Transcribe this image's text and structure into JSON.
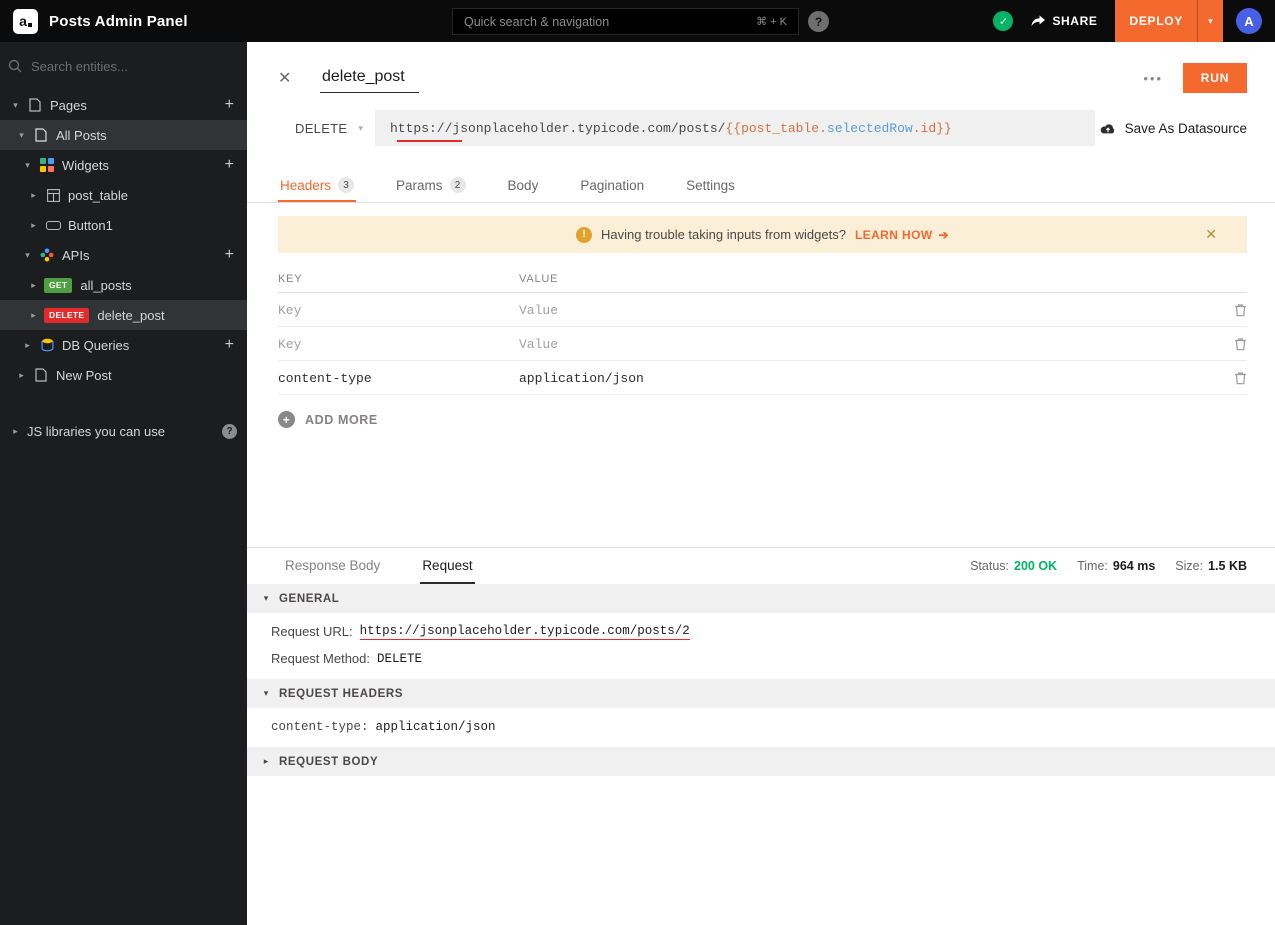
{
  "colors": {
    "accent": "#f3692e",
    "method-red": "#e22c2c",
    "method-green": "#4e9e42",
    "status-green": "#03b365",
    "code-orange": "#d7713d",
    "code-blue": "#5b9dd9",
    "banner-bg": "#fbf0d7",
    "banner-icon": "#dfa32e",
    "avatar-blue": "#4661e6"
  },
  "icons": {
    "caret_down": "▾",
    "caret_right": "▸",
    "close": "✕",
    "dots": "•••",
    "plus": "+",
    "arrow_right": "➔",
    "check": "✓",
    "warning": "!",
    "help": "?",
    "logo_letter": "a"
  },
  "topbar": {
    "app_title": "Posts Admin Panel",
    "search_placeholder": "Quick search & navigation",
    "shortcut": "⌘ + K",
    "share_label": "SHARE",
    "deploy_label": "DEPLOY",
    "avatar_initial": "A"
  },
  "sidebar": {
    "search_placeholder": "Search entities...",
    "pages": "Pages",
    "all_posts_page": "All Posts",
    "widgets": "Widgets",
    "post_table": "post_table",
    "button1": "Button1",
    "apis": "APIs",
    "get_badge": "GET",
    "all_posts_api": "all_posts",
    "delete_badge": "DELETE",
    "delete_post_api": "delete_post",
    "db_queries": "DB Queries",
    "new_post": "New Post",
    "js_libraries": "JS libraries you can use"
  },
  "editor": {
    "title": "delete_post",
    "run_label": "RUN",
    "method": "DELETE",
    "url": {
      "base": "https://jsonplaceholder.typicode.com/posts/",
      "seg_open": "{{post_table.",
      "seg_property": "selectedRow",
      "seg_close": ".id}}"
    },
    "save_as_datasource": "Save As Datasource",
    "tabs": [
      {
        "label": "Headers",
        "badge": "3"
      },
      {
        "label": "Params",
        "badge": "2"
      },
      {
        "label": "Body"
      },
      {
        "label": "Pagination"
      },
      {
        "label": "Settings"
      }
    ],
    "banner": {
      "text": "Having trouble taking inputs from widgets?",
      "link": "LEARN HOW"
    },
    "headers_table": {
      "key_header": "KEY",
      "value_header": "VALUE",
      "rows": [
        {
          "key": "",
          "value": "",
          "key_placeholder": "Key",
          "value_placeholder": "Value"
        },
        {
          "key": "",
          "value": "",
          "key_placeholder": "Key",
          "value_placeholder": "Value"
        },
        {
          "key": "content-type",
          "value": "application/json"
        }
      ],
      "add_more": "ADD MORE"
    }
  },
  "response": {
    "tabs": [
      "Response Body",
      "Request"
    ],
    "status_label": "Status:",
    "status_value": "200 OK",
    "time_label": "Time:",
    "time_value": "964 ms",
    "size_label": "Size:",
    "size_value": "1.5 KB",
    "general": {
      "title": "GENERAL",
      "request_url_label": "Request URL:",
      "request_url": "https://jsonplaceholder.typicode.com/posts/2",
      "request_method_label": "Request Method:",
      "request_method": "DELETE"
    },
    "request_headers": {
      "title": "REQUEST HEADERS",
      "content_type_label": "content-type:",
      "content_type_value": "application/json"
    },
    "request_body": {
      "title": "REQUEST BODY"
    }
  }
}
